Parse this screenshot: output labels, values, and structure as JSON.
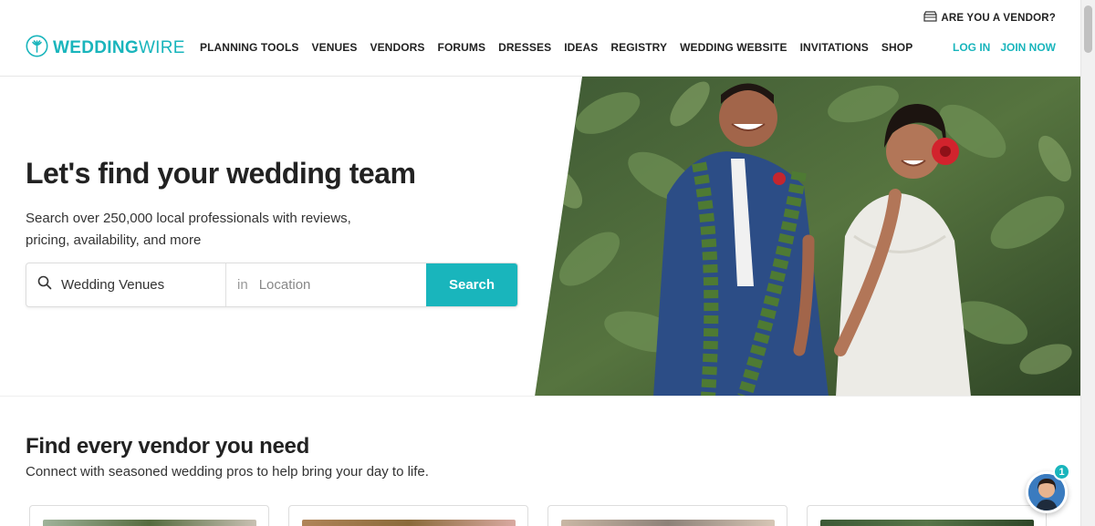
{
  "header": {
    "vendor_link": "ARE YOU A VENDOR?",
    "logo": {
      "part1": "WEDDING",
      "part2": "WIRE"
    },
    "nav": [
      "PLANNING TOOLS",
      "VENUES",
      "VENDORS",
      "FORUMS",
      "DRESSES",
      "IDEAS",
      "REGISTRY",
      "WEDDING WEBSITE",
      "INVITATIONS",
      "SHOP"
    ],
    "login": "LOG IN",
    "join": "JOIN NOW"
  },
  "hero": {
    "title": "Let's find your wedding team",
    "subtitle": "Search over 250,000 local professionals with reviews, pricing, availability, and more",
    "search": {
      "what_value": "Wedding Venues",
      "in_label": "in",
      "location_placeholder": "Location",
      "button": "Search"
    }
  },
  "vendors_section": {
    "title": "Find every vendor you need",
    "subtitle": "Connect with seasoned wedding pros to help bring your day to life."
  },
  "chat": {
    "badge_count": "1"
  },
  "colors": {
    "brand": "#19b5bc",
    "text": "#222222"
  },
  "icons": {
    "vendor": "storefront-icon",
    "logo": "wedding-wire-logo-icon",
    "search": "search-icon",
    "chat": "chat-avatar-icon"
  }
}
